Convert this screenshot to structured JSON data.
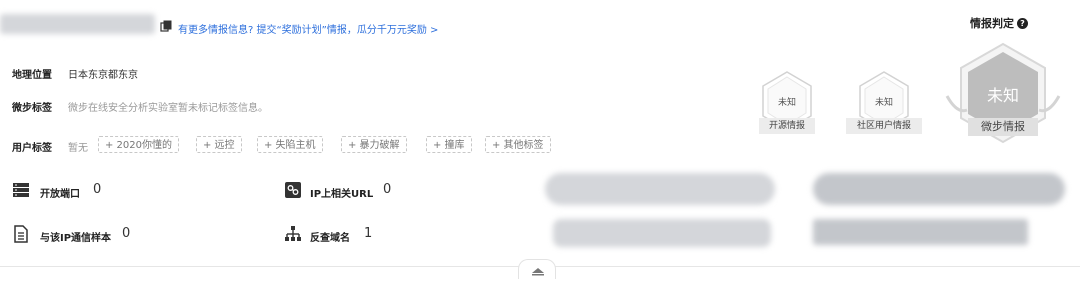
{
  "header": {
    "report_link": "有更多情报信息? 提交“奖励计划”情报，瓜分千万元奖励 >",
    "copy_icon": "copy-icon"
  },
  "info": {
    "location_label": "地理位置",
    "location_value": "日本东京都东京",
    "weibu_tag_label": "微步标签",
    "weibu_tag_value": "微步在线安全分析实验室暂未标记标签信息。",
    "user_tag_label": "用户标签",
    "user_tag_value": "暂无",
    "user_tags": [
      "+ 2020你懂的",
      "+ 远控",
      "+ 失陷主机",
      "+ 暴力破解",
      "+ 撞库",
      "+ 其他标签"
    ]
  },
  "stats": {
    "open_ports": {
      "label": "开放端口",
      "value": "0",
      "icon": "server-icon"
    },
    "ip_urls": {
      "label": "IP上相关URL",
      "value": "0",
      "icon": "link-icon"
    },
    "comm_samples": {
      "label": "与该IP通信样本",
      "value": "0",
      "icon": "document-icon"
    },
    "reverse_domains": {
      "label": "反查域名",
      "value": "1",
      "icon": "network-icon"
    }
  },
  "verdict": {
    "title": "情报判定",
    "help_icon": "question-icon",
    "sources": [
      {
        "status": "未知",
        "label": "开源情报"
      },
      {
        "status": "未知",
        "label": "社区用户情报"
      },
      {
        "status": "未知",
        "label": "微步情报"
      }
    ]
  },
  "colors": {
    "link": "#2d6fdc",
    "badge_main": "#bdbdbd",
    "text": "#222222"
  }
}
